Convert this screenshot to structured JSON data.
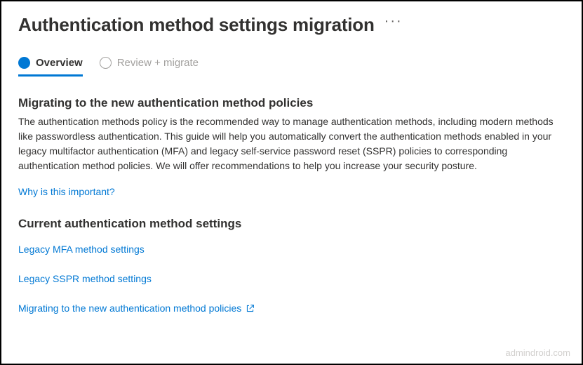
{
  "header": {
    "title": "Authentication method settings migration"
  },
  "tabs": [
    {
      "label": "Overview"
    },
    {
      "label": "Review + migrate"
    }
  ],
  "sections": {
    "migrating": {
      "heading": "Migrating to the new authentication method policies",
      "body": "The authentication methods policy is the recommended way to manage authentication methods, including modern methods like passwordless authentication. This guide will help you automatically convert the authentication methods enabled in your legacy multifactor authentication (MFA) and legacy self-service password reset (SSPR) policies to corresponding authentication method policies. We will offer recommendations to help you increase your security posture."
    },
    "current": {
      "heading": "Current authentication method settings"
    }
  },
  "links": {
    "why": "Why is this important?",
    "legacy_mfa": "Legacy MFA method settings",
    "legacy_sspr": "Legacy SSPR method settings",
    "migrating_external": "Migrating to the new authentication method policies"
  },
  "watermark": "admindroid.com"
}
